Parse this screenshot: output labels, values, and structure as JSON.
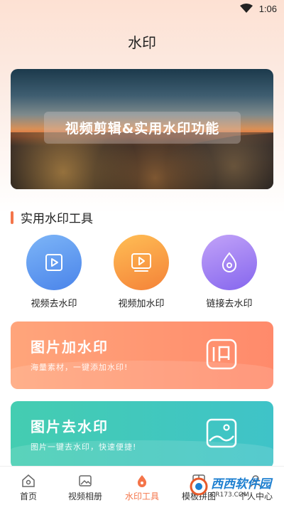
{
  "status": {
    "time": "1:06"
  },
  "page": {
    "title": "水印"
  },
  "banner": {
    "caption": "视频剪辑&实用水印功能"
  },
  "section": {
    "title": "实用水印工具"
  },
  "tools": [
    {
      "label": "视频去水印",
      "icon": "video-play-icon",
      "color_from": "#6faaf5",
      "color_to": "#4a86eb"
    },
    {
      "label": "视频加水印",
      "icon": "video-frame-icon",
      "color_from": "#ffb347",
      "color_to": "#f4843c"
    },
    {
      "label": "链接去水印",
      "icon": "water-drop-icon",
      "color_from": "#b99af7",
      "color_to": "#8a6cf0"
    }
  ],
  "cards": [
    {
      "title": "图片加水印",
      "subtitle": "海量素材，一键添加水印!",
      "icon": "stamp-icon",
      "color_from": "#ffa27a",
      "color_to": "#ff8a6a"
    },
    {
      "title": "图片去水印",
      "subtitle": "图片一键去水印，快速便捷!",
      "icon": "image-icon",
      "color_from": "#4fd2b5",
      "color_to": "#3cbfc4"
    }
  ],
  "tabbar": {
    "items": [
      {
        "label": "首页",
        "icon": "home-icon"
      },
      {
        "label": "视频相册",
        "icon": "photo-icon"
      },
      {
        "label": "水印工具",
        "icon": "watermark-tool-icon",
        "active": true
      },
      {
        "label": "模板拼图",
        "icon": "template-icon"
      },
      {
        "label": "个人中心",
        "icon": "user-icon"
      }
    ]
  },
  "overlay": {
    "brand": "西西软件园",
    "url": "CR173.COM"
  }
}
